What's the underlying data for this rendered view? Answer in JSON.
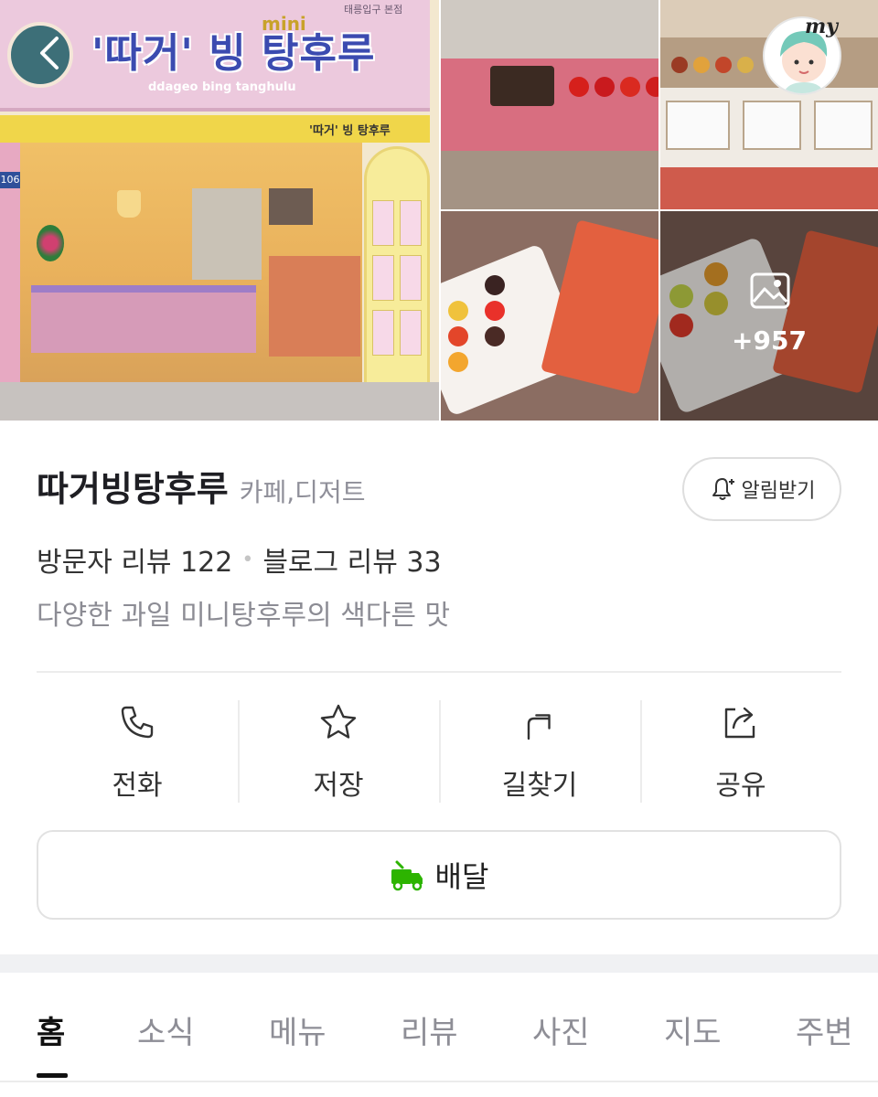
{
  "gallery": {
    "sign_title": "'따거' 빙 탕후루",
    "sign_mini": "mini",
    "sign_sub": "ddageo bing tanghulu",
    "sign_addr": "태릉입구 본점",
    "awning_text": "'따거' 빙 탕후루",
    "building_no": "106",
    "more_count": "+957",
    "my_label": "my",
    "icons": [
      "back-arrow-icon",
      "image-icon",
      "profile-avatar-icon"
    ]
  },
  "place": {
    "name": "따거빙탕후루",
    "category": "카페,디저트",
    "alert_label": "알림받기",
    "visitor_reviews": "방문자 리뷰 122",
    "blog_reviews": "블로그 리뷰 33",
    "separator": "•",
    "description": "다양한 과일 미니탕후루의 색다른 맛"
  },
  "actions": [
    {
      "label": "전화",
      "icon": "phone-icon"
    },
    {
      "label": "저장",
      "icon": "star-icon"
    },
    {
      "label": "길찾기",
      "icon": "directions-icon"
    },
    {
      "label": "공유",
      "icon": "share-icon"
    }
  ],
  "delivery": {
    "label": "배달",
    "icon": "delivery-truck-icon",
    "color": "#2db400"
  },
  "tabs": [
    "홈",
    "소식",
    "메뉴",
    "리뷰",
    "사진",
    "지도",
    "주변"
  ],
  "active_tab": "홈",
  "colors": {
    "text": "#1e1e23",
    "muted": "#8f8f99",
    "divider": "#ececec",
    "accent": "#2db400"
  }
}
